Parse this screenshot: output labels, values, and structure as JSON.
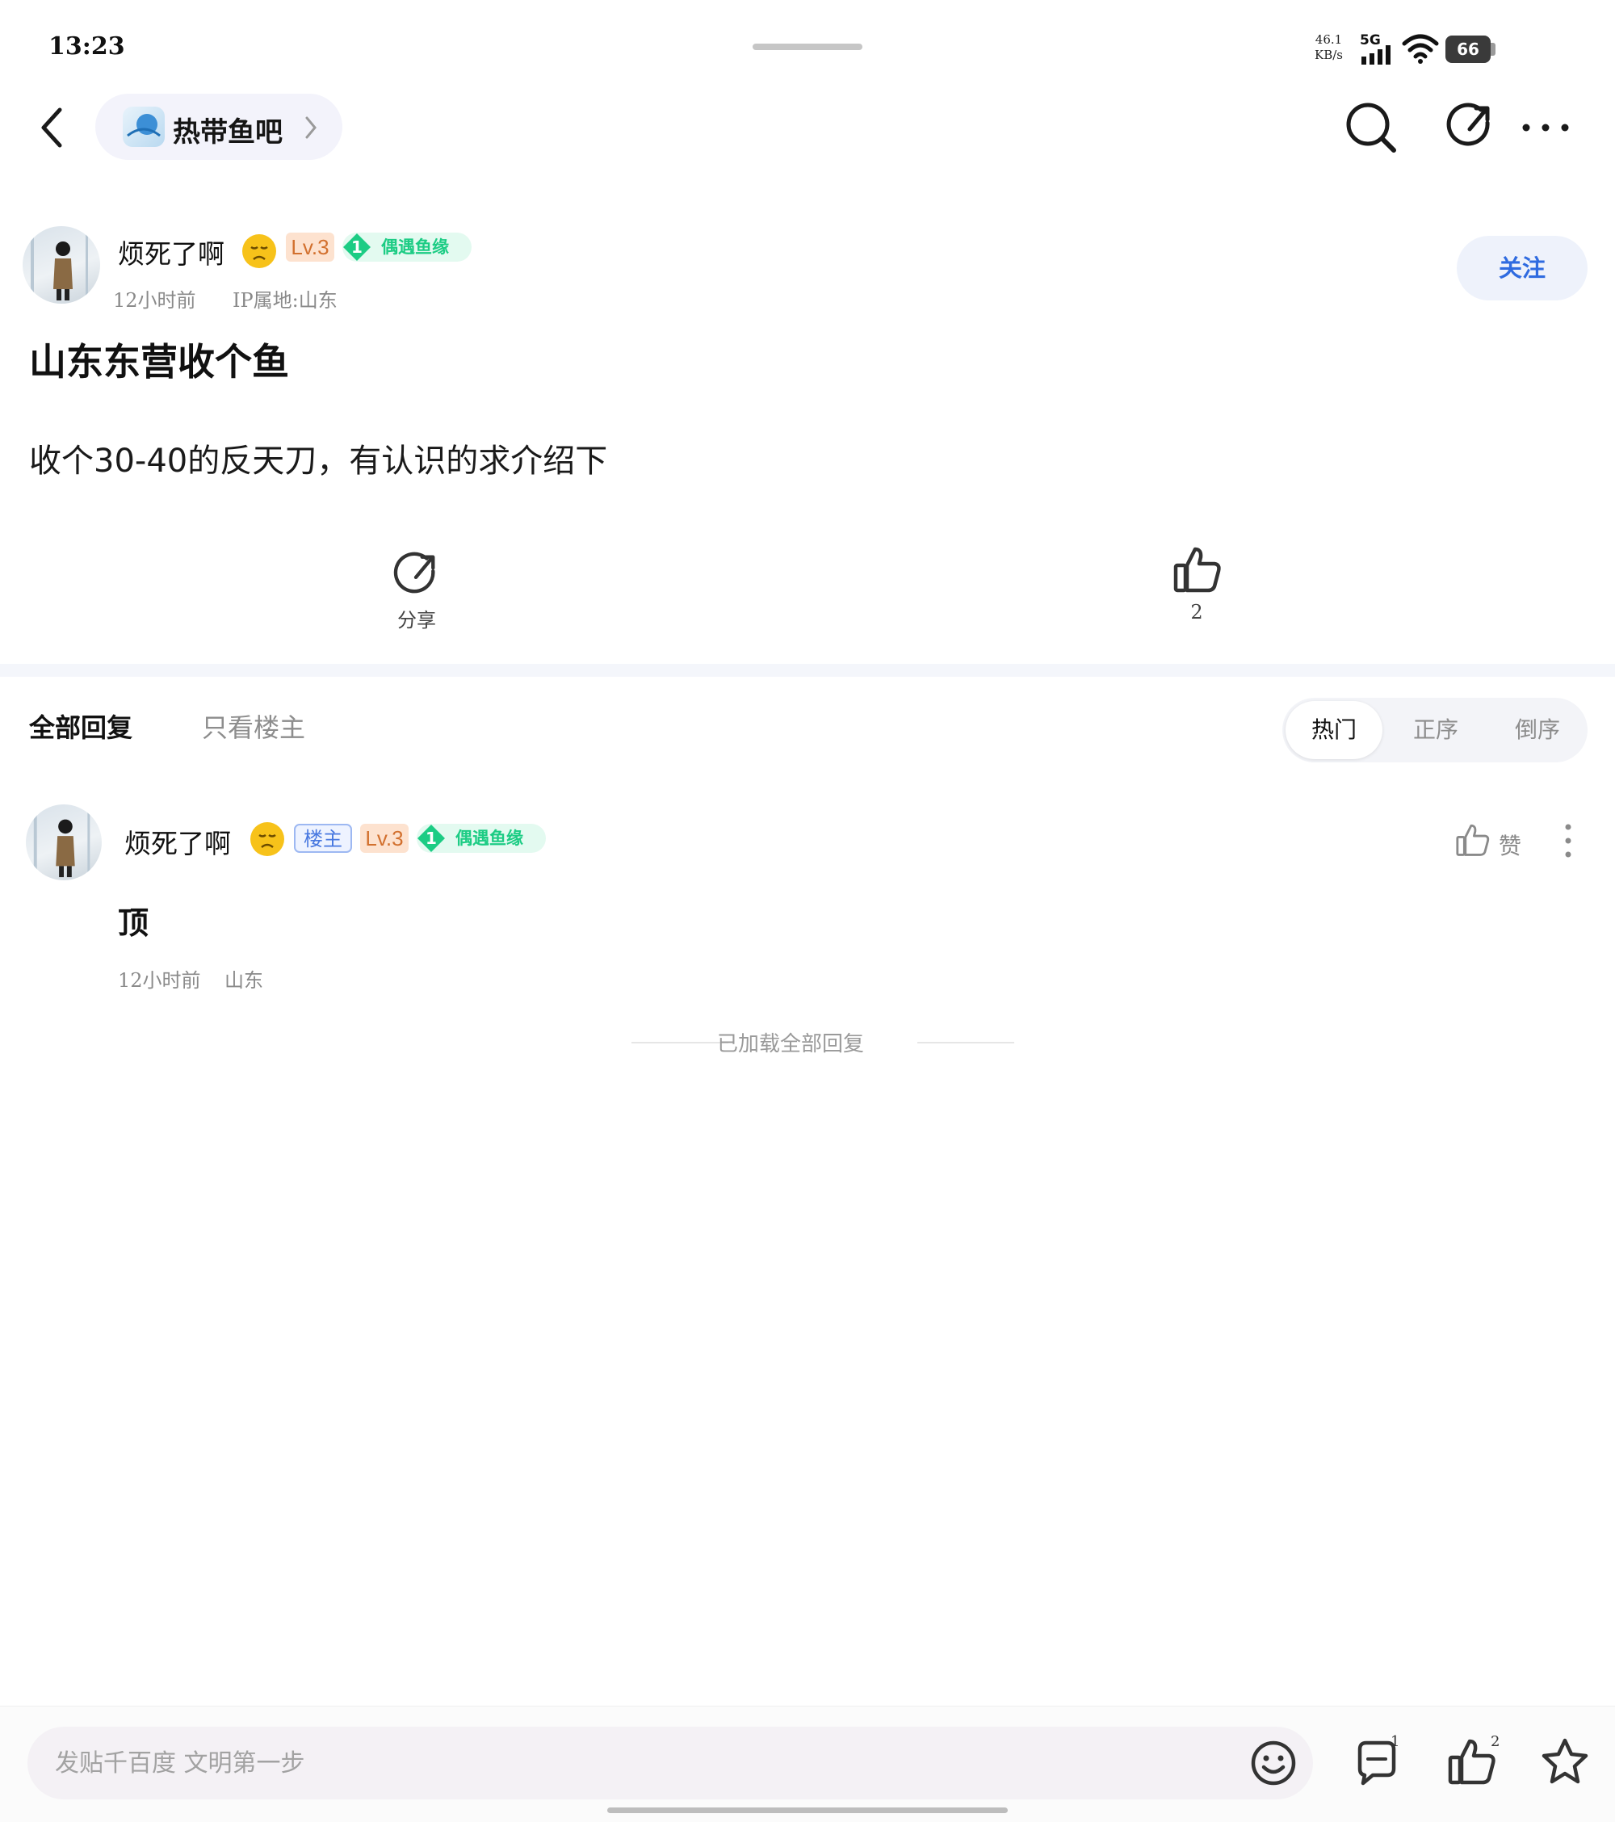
{
  "status_bar": {
    "time": "13:23",
    "net_speed_value": "46.1",
    "net_speed_unit": "KB/s",
    "signal_label": "5G",
    "battery": "66"
  },
  "header": {
    "forum_name": "热带鱼吧"
  },
  "post": {
    "author": "烦死了啊",
    "level": "Lv.3",
    "fan_level": "1",
    "fan_title": "偶遇鱼缘",
    "time": "12小时前",
    "ip_location": "IP属地:山东",
    "follow_label": "关注",
    "title": "山东东营收个鱼",
    "body": "收个30-40的反天刀，有认识的求介绍下",
    "share_label": "分享",
    "like_count": "2"
  },
  "replies_header": {
    "tab_all": "全部回复",
    "tab_owner_only": "只看楼主",
    "sort_options": [
      "热门",
      "正序",
      "倒序"
    ],
    "sort_selected": "热门"
  },
  "replies": [
    {
      "author": "烦死了啊",
      "owner_badge": "楼主",
      "level": "Lv.3",
      "fan_level": "1",
      "fan_title": "偶遇鱼缘",
      "text": "顶",
      "time": "12小时前",
      "location": "山东",
      "like_label": "赞"
    }
  ],
  "end_notice": "已加载全部回复",
  "bottom_bar": {
    "input_placeholder": "发贴千百度 文明第一步",
    "comment_count": "1",
    "like_count": "2"
  },
  "icons": {
    "back": "chevron-left-icon",
    "forum_arrow": "chevron-right-icon",
    "search": "search-icon",
    "share": "share-icon",
    "more": "more-icon",
    "like": "thumbs-up-icon",
    "emoji": "smiley-icon",
    "comment": "comment-icon",
    "star": "star-icon"
  },
  "colors": {
    "accent_blue": "#2f6be0",
    "level_orange": "#d2702e",
    "fan_green": "#1ccc84",
    "muted_text": "#8a8a8a"
  }
}
